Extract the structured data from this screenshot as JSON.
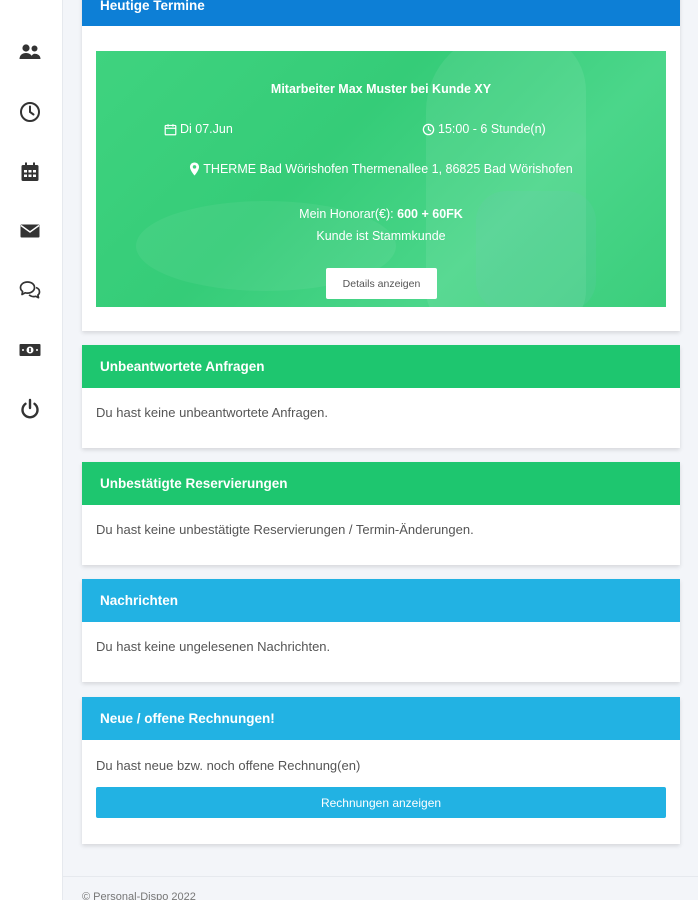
{
  "sidebar": {
    "items": [
      {
        "icon": "users-icon"
      },
      {
        "icon": "clock-icon"
      },
      {
        "icon": "calendar-icon"
      },
      {
        "icon": "envelope-icon"
      },
      {
        "icon": "chat-icon"
      },
      {
        "icon": "money-icon"
      },
      {
        "icon": "power-icon"
      }
    ]
  },
  "today": {
    "header": "Heutige Termine",
    "appointment": {
      "title": "Mitarbeiter Max Muster bei Kunde XY",
      "date": "Di 07.Jun",
      "time": "15:00 - 6 Stunde(n)",
      "location": "THERME Bad Wörishofen Thermenallee 1, 86825 Bad Wörishofen",
      "fee_label": "Mein Honorar(€):",
      "fee_value": "600 + 60FK",
      "customer_status": "Kunde ist Stammkunde",
      "details_button": "Details anzeigen"
    }
  },
  "inquiries": {
    "header": "Unbeantwortete Anfragen",
    "body": "Du hast keine unbeantwortete Anfragen."
  },
  "reservations": {
    "header": "Unbestätigte Reservierungen",
    "body": "Du hast keine unbestätigte Reservierungen / Termin-Änderungen."
  },
  "messages": {
    "header": "Nachrichten",
    "body": "Du hast keine ungelesenen Nachrichten."
  },
  "invoices": {
    "header": "Neue / offene Rechnungen!",
    "body": "Du hast neue bzw. noch offene Rechnung(en)",
    "button": "Rechnungen anzeigen"
  },
  "footer": {
    "copyright": "© Personal-Dispo 2022"
  },
  "colors": {
    "header_blue": "#0d7fd6",
    "header_green": "#1ec66f",
    "header_cyan": "#22b2e3",
    "appointment_bg": "#3fd37f"
  }
}
